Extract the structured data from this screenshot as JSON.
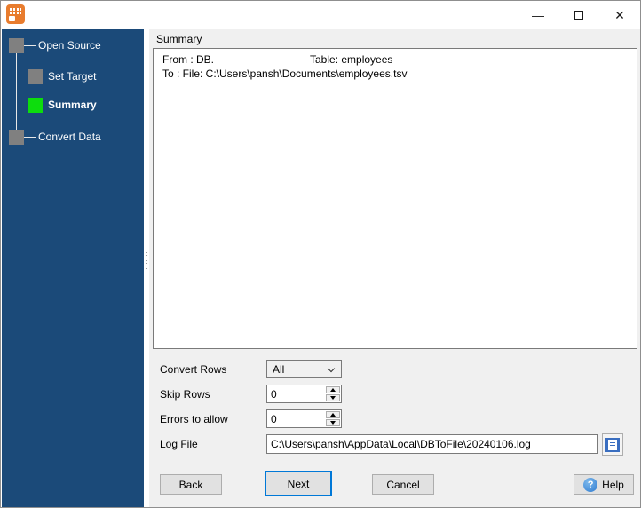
{
  "window": {
    "controls": {
      "minimize_glyph": "—",
      "close_glyph": "✕"
    }
  },
  "sidebar": {
    "steps": [
      {
        "label": "Open Source",
        "active": false
      },
      {
        "label": "Set Target",
        "active": false
      },
      {
        "label": "Summary",
        "active": true
      },
      {
        "label": "Convert Data",
        "active": false
      }
    ],
    "colors": {
      "background": "#1b4a79",
      "active_square": "#0ddd0d",
      "inactive_square": "#808080"
    }
  },
  "main": {
    "group_label": "Summary",
    "summary_box": {
      "from_label": "From : DB.",
      "table_label": "Table: employees",
      "to_label": "To : File: C:\\Users\\pansh\\Documents\\employees.tsv"
    },
    "form": {
      "convert_rows": {
        "label": "Convert Rows",
        "value": "All"
      },
      "skip_rows": {
        "label": "Skip Rows",
        "value": "0"
      },
      "errors_to_allow": {
        "label": "Errors to allow",
        "value": "0"
      },
      "log_file": {
        "label": "Log File",
        "value": "C:\\Users\\pansh\\AppData\\Local\\DBToFile\\20240106.log"
      }
    },
    "buttons": {
      "back": "Back",
      "next": "Next",
      "cancel": "Cancel",
      "help": "Help",
      "help_icon_glyph": "?"
    }
  },
  "colors": {
    "accent_blue": "#0078d7",
    "panel_gray": "#f0f0f0",
    "icon_orange": "#e87c2e"
  }
}
